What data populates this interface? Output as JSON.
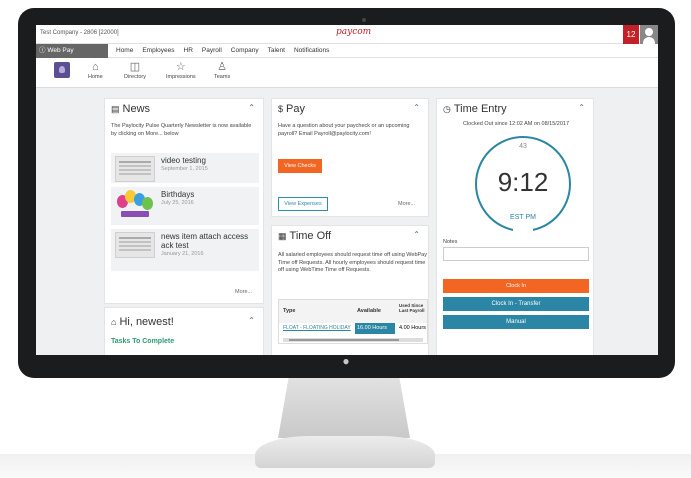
{
  "topbar": {
    "company": "Test Company - 2806 [22000]",
    "brand": "paycom",
    "notification_count": "12"
  },
  "navbar": {
    "webpay_label": "Web Pay",
    "items": [
      "Home",
      "Employees",
      "HR",
      "Payroll",
      "Company",
      "Talent",
      "Notifications"
    ]
  },
  "quick_tools": [
    {
      "label": "Home",
      "icon": "home-icon"
    },
    {
      "label": "Directory",
      "icon": "directory-icon"
    },
    {
      "label": "Impressions",
      "icon": "star-icon"
    },
    {
      "label": "Teams",
      "icon": "teams-icon"
    }
  ],
  "news": {
    "title": "News",
    "intro": "The Paylocity Pulse Quarterly Newsletter is now available by clicking on More... below",
    "items": [
      {
        "title": "video testing",
        "date": "September 1, 2015"
      },
      {
        "title": "Birthdays",
        "date": "July 25, 2016"
      },
      {
        "title": "news item attach access ack test",
        "date": "January 21, 2016"
      }
    ],
    "more": "More..."
  },
  "greeting": {
    "title": "Hi, newest!",
    "tasks": "Tasks To Complete"
  },
  "pay": {
    "title": "Pay",
    "body": "Have a question about your paycheck or an upcoming payroll? Email Payroll@paylocity.com!",
    "view_checks": "View Checks",
    "view_expenses": "View Expenses",
    "more": "More..."
  },
  "time_off": {
    "title": "Time Off",
    "body": "All salaried employees should request time off using WebPay Time off Requests. All hourly employees should request time off using WebTime Time off Requests.",
    "columns": [
      "Type",
      "Available",
      "Used Since Last Payroll"
    ],
    "rows": [
      {
        "type": "FLOAT - FLOATING HOLIDAY",
        "available": "16.00 Hours",
        "used": "4.00 Hours"
      }
    ]
  },
  "time_entry": {
    "title": "Time Entry",
    "status": "Clocked Out since 12:02 AM on 08/15/2017",
    "seconds": "43",
    "time": "9:12",
    "zone": "EST  PM",
    "notes_label": "Notes",
    "notes_value": "",
    "clock_in": "Clock In",
    "clock_in_transfer": "Clock In - Transfer",
    "manual": "Manual"
  },
  "colors": {
    "brand_red": "#c32028",
    "orange": "#f26522",
    "teal": "#2a86a4"
  }
}
